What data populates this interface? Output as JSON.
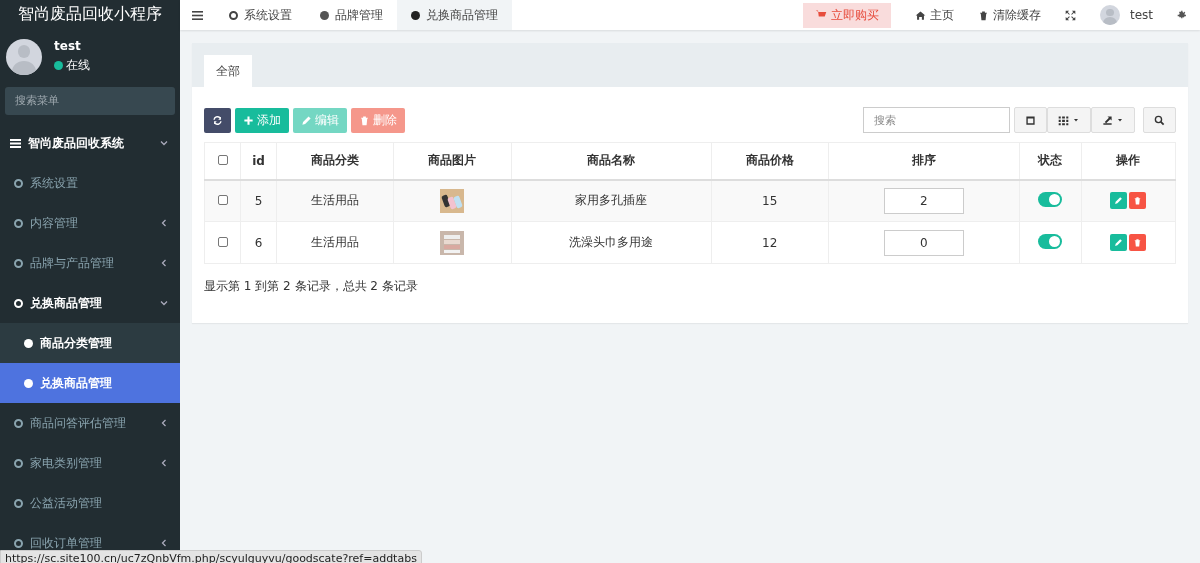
{
  "app_title": "智尚废品回收小程序",
  "user": {
    "name": "test",
    "status": "在线",
    "online": true
  },
  "menu_search": {
    "placeholder": "搜索菜单"
  },
  "menu": [
    {
      "label": "智尚废品回收系统",
      "expanded": true,
      "children": [
        {
          "label": "系统设置",
          "selected": false
        },
        {
          "label": "内容管理",
          "selected": false,
          "expanded": false
        },
        {
          "label": "品牌与产品管理",
          "selected": false,
          "expanded": false
        },
        {
          "label": "兑换商品管理",
          "selected": false,
          "expanded": true,
          "children": [
            {
              "label": "商品分类管理",
              "selected": false
            },
            {
              "label": "兑换商品管理",
              "selected": true
            }
          ]
        },
        {
          "label": "商品问答评估管理",
          "selected": false,
          "expanded": false
        },
        {
          "label": "家电类别管理",
          "selected": false,
          "expanded": false
        },
        {
          "label": "公益活动管理",
          "selected": false
        },
        {
          "label": "回收订单管理",
          "selected": false,
          "expanded": false
        }
      ]
    }
  ],
  "tabs": [
    {
      "label": "系统设置",
      "kind": "outline",
      "selected": false
    },
    {
      "label": "品牌管理",
      "kind": "filled",
      "selected": false
    },
    {
      "label": "兑换商品管理",
      "kind": "filled",
      "selected": true
    }
  ],
  "header_actions": {
    "buy": "立即购买",
    "home": "主页",
    "clear_cache": "清除缓存",
    "user": "test"
  },
  "panel_tabs": [
    {
      "label": "全部",
      "selected": true
    }
  ],
  "toolbar": {
    "add": "添加",
    "edit": "编辑",
    "delete": "删除",
    "search": {
      "placeholder": "搜索"
    }
  },
  "table": {
    "select_all_checked": false,
    "columns": [
      "id",
      "商品分类",
      "商品图片",
      "商品名称",
      "商品价格",
      "排序",
      "状态",
      "操作"
    ],
    "rows": [
      {
        "checked": false,
        "id": "5",
        "category": "生活用品",
        "name": "家用多孔插座",
        "price": "15",
        "sort": "2",
        "on": true
      },
      {
        "checked": false,
        "id": "6",
        "category": "生活用品",
        "name": "洗澡头巾多用途",
        "price": "12",
        "sort": "0",
        "on": true
      }
    ]
  },
  "pagination_info": "显示第 1 到第 2 条记录，总共 2 条记录",
  "status_url": "https://sc.site100.cn/uc7zQnbVfm.php/scyulguyvu/goodscate?ref=addtabs"
}
